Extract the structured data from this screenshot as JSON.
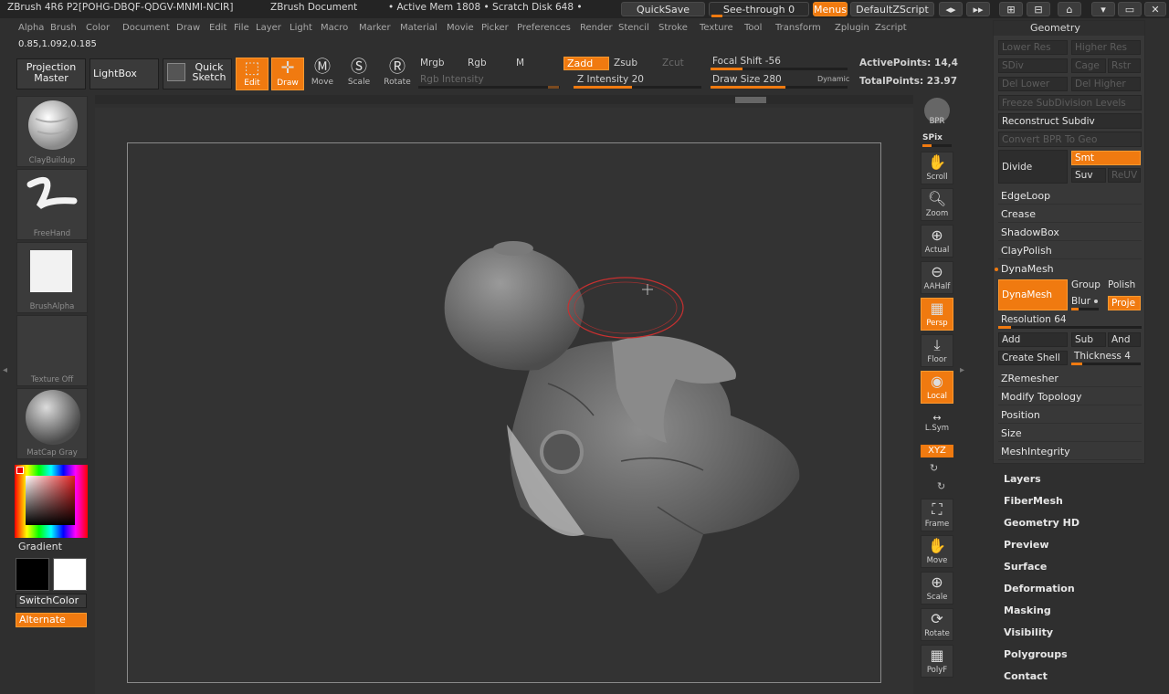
{
  "titlebar": {
    "app": "ZBrush 4R6  P2[POHG-DBQF-QDGV-MNMI-NCIR]",
    "document": "ZBrush Document",
    "mem": "• Active Mem 1808 • Scratch Disk 648 •",
    "quicksave": "QuickSave",
    "seethrough": "See-through   0",
    "menus": "Menus",
    "script": "DefaultZScript"
  },
  "menubar": [
    "Alpha",
    "Brush",
    "Color",
    "Document",
    "Draw",
    "Edit",
    "File",
    "Layer",
    "Light",
    "Macro",
    "Marker",
    "Material",
    "Movie",
    "Picker",
    "Preferences",
    "Render",
    "Stencil",
    "Stroke",
    "Texture",
    "Tool",
    "Transform",
    "Zplugin",
    "Zscript"
  ],
  "coords": "0.85,1.092,0.185",
  "toolbar": {
    "projection_master": "Projection Master",
    "lightbox": "LightBox",
    "quick_sketch": "Quick Sketch",
    "edit": "Edit",
    "draw": "Draw",
    "move": "Move",
    "scale": "Scale",
    "rotate": "Rotate",
    "mrgb": "Mrgb",
    "rgb": "Rgb",
    "m": "M",
    "zadd": "Zadd",
    "zsub": "Zsub",
    "zcut": "Zcut",
    "rgb_intensity": "Rgb Intensity",
    "z_intensity": "Z Intensity 20",
    "focal_shift": "Focal Shift -56",
    "draw_size": "Draw Size 280",
    "dynamic": "Dynamic",
    "active_points": "ActivePoints: 14,4",
    "total_points": "TotalPoints: 23.97"
  },
  "shelf": {
    "brush": "ClayBuildup",
    "stroke": "FreeHand",
    "alpha": "BrushAlpha",
    "texture": "Texture Off",
    "material": "MatCap Gray",
    "gradient": "Gradient",
    "switchcolor": "SwitchColor",
    "alternate": "Alternate"
  },
  "right_tools": [
    "BPR",
    "SPix",
    "Scroll",
    "Zoom",
    "Actual",
    "AAHalf",
    "Persp",
    "Floor",
    "Local",
    "L.Sym",
    "XYZ",
    "Frame",
    "Move",
    "Scale",
    "Rotate",
    "PolyF"
  ],
  "geometry": {
    "title": "Geometry",
    "lower_res": "Lower Res",
    "higher_res": "Higher Res",
    "sdiv": "SDiv",
    "cage": "Cage",
    "rstr": "Rstr",
    "del_lower": "Del Lower",
    "del_higher": "Del Higher",
    "freeze": "Freeze SubDivision Levels",
    "reconstruct": "Reconstruct Subdiv",
    "convert_bpr": "Convert BPR To Geo",
    "divide": "Divide",
    "smt": "Smt",
    "suv": "Suv",
    "reuv": "ReUV",
    "edgeloop": "EdgeLoop",
    "crease": "Crease",
    "shadowbox": "ShadowBox",
    "claypolish": "ClayPolish",
    "dynamesh_header": "DynaMesh",
    "dynamesh_btn": "DynaMesh",
    "group": "Group",
    "polish": "Polish",
    "blur": "Blur",
    "project": "Proje",
    "resolution": "Resolution 64",
    "add": "Add",
    "sub": "Sub",
    "and": "And",
    "create_shell": "Create Shell",
    "thickness": "Thickness 4",
    "zremesher": "ZRemesher",
    "modify_topology": "Modify Topology",
    "position": "Position",
    "size": "Size",
    "meshintegrity": "MeshIntegrity"
  },
  "palettes": [
    "Layers",
    "FiberMesh",
    "Geometry HD",
    "Preview",
    "Surface",
    "Deformation",
    "Masking",
    "Visibility",
    "Polygroups",
    "Contact"
  ]
}
